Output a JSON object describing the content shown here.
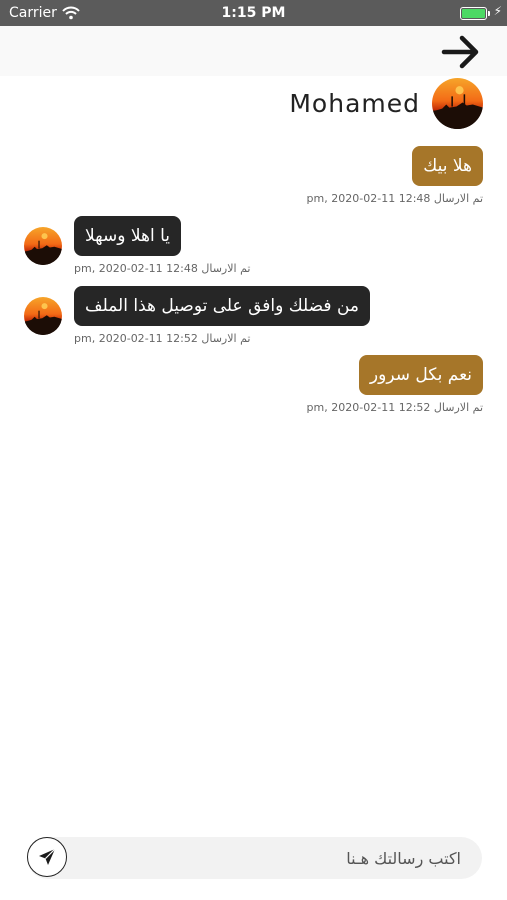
{
  "status_bar": {
    "carrier": "Carrier",
    "time": "1:15 PM",
    "battery_icon": "battery-full-charging-icon",
    "wifi_icon": "wifi-icon"
  },
  "header": {
    "back_icon": "arrow-right-icon",
    "contact_name": "Mohamed",
    "avatar_icon": "sunset-avatar-icon"
  },
  "messages": [
    {
      "direction": "sent",
      "text": "هلا بيك",
      "meta": "تم الارسال 12:48 11-02-2020 ,pm"
    },
    {
      "direction": "received",
      "text": "يا اهلا وسهلا",
      "meta": "تم الارسال 12:48 11-02-2020 ,pm"
    },
    {
      "direction": "received",
      "text": "من فضلك وافق على توصيل هذا الملف",
      "meta": "تم الارسال 12:52 11-02-2020 ,pm"
    },
    {
      "direction": "sent",
      "text": "نعم بكل سرور",
      "meta": "تم الارسال 12:52 11-02-2020 ,pm"
    }
  ],
  "composer": {
    "placeholder": "اكتب رسالتك هـنا",
    "send_icon": "paper-plane-icon"
  },
  "colors": {
    "sent_bubble": "#a67629",
    "received_bubble": "#262626",
    "status_bar": "#5b5b5b"
  }
}
